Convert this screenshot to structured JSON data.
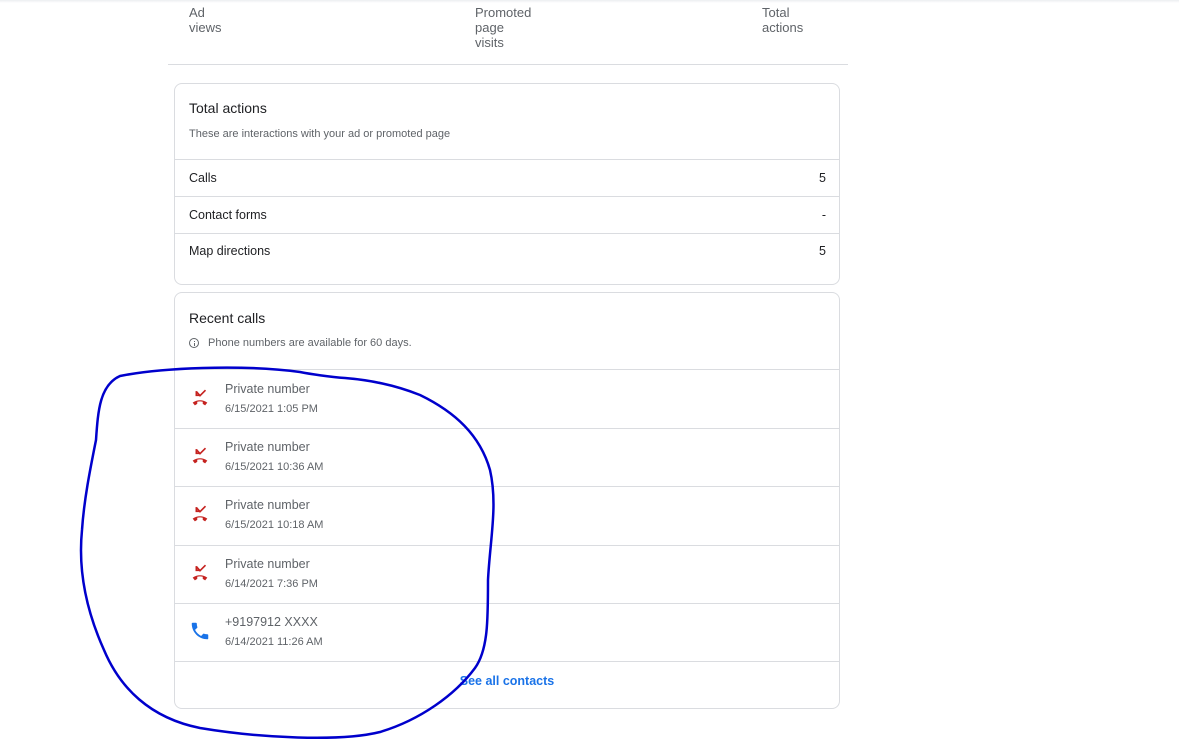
{
  "stats": {
    "ad_views": [
      "Ad",
      "views"
    ],
    "promoted_page_visits": [
      "Promoted",
      "page",
      "visits"
    ],
    "total_actions": [
      "Total",
      "actions"
    ]
  },
  "total_actions_card": {
    "title": "Total actions",
    "subtitle": "These are interactions with your ad or promoted page",
    "rows": [
      {
        "label": "Calls",
        "value": "5"
      },
      {
        "label": "Contact forms",
        "value": "-"
      },
      {
        "label": "Map directions",
        "value": "5"
      }
    ]
  },
  "recent_calls_card": {
    "title": "Recent calls",
    "info": "Phone numbers are available for 60 days.",
    "calls": [
      {
        "name": "Private number",
        "time": "6/15/2021 1:05 PM",
        "icon": "missed-call-icon"
      },
      {
        "name": "Private number",
        "time": "6/15/2021 10:36 AM",
        "icon": "missed-call-icon"
      },
      {
        "name": "Private number",
        "time": "6/15/2021 10:18 AM",
        "icon": "missed-call-icon"
      },
      {
        "name": "Private number",
        "time": "6/14/2021 7:36 PM",
        "icon": "missed-call-icon"
      },
      {
        "name": "+9197912 XXXX",
        "time": "6/14/2021 11:26 AM",
        "icon": "phone-icon"
      }
    ],
    "see_all_label": "See all contacts"
  },
  "colors": {
    "missed_call": "#c5221f",
    "answered_call": "#1a73e8",
    "link": "#1a73e8",
    "annotation": "#0000cc"
  }
}
